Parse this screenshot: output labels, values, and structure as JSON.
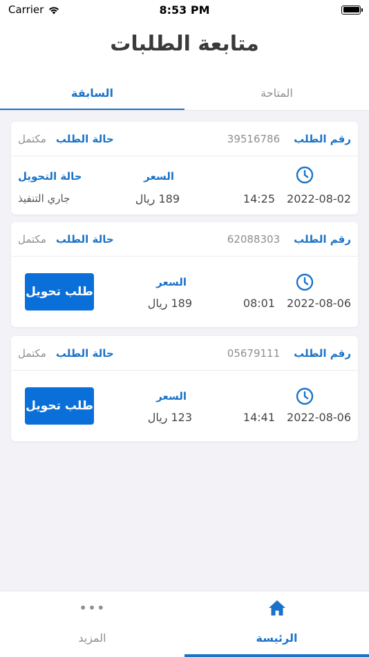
{
  "status_bar": {
    "carrier": "Carrier",
    "time": "8:53 PM"
  },
  "header": {
    "title": "متابعة الطلبات"
  },
  "tabs": [
    {
      "label": "المتاحة",
      "active": false
    },
    {
      "label": "السابقة",
      "active": true
    }
  ],
  "labels": {
    "order_number": "رقم الطلب",
    "order_status": "حالة الطلب",
    "price": "السعر",
    "transfer_status": "حالة التحويل",
    "transfer_request": "طلب تحويل"
  },
  "orders": [
    {
      "number": "39516786",
      "status": "مكتمل",
      "date": "2022-08-02",
      "time": "14:25",
      "price": "189 ريال",
      "transfer_status": "جاري التنفيذ"
    },
    {
      "number": "62088303",
      "status": "مكتمل",
      "date": "2022-08-06",
      "time": "08:01",
      "price": "189 ريال"
    },
    {
      "number": "05679111",
      "status": "مكتمل",
      "date": "2022-08-06",
      "time": "14:41",
      "price": "123 ريال"
    }
  ],
  "bottom_nav": [
    {
      "label": "المزيد",
      "icon": "more-dots-icon",
      "active": false
    },
    {
      "label": "الرئيسة",
      "icon": "home-icon",
      "active": true
    }
  ],
  "colors": {
    "accent": "#1a73c9",
    "button": "#0a6fd8",
    "muted": "#8e8e93"
  }
}
